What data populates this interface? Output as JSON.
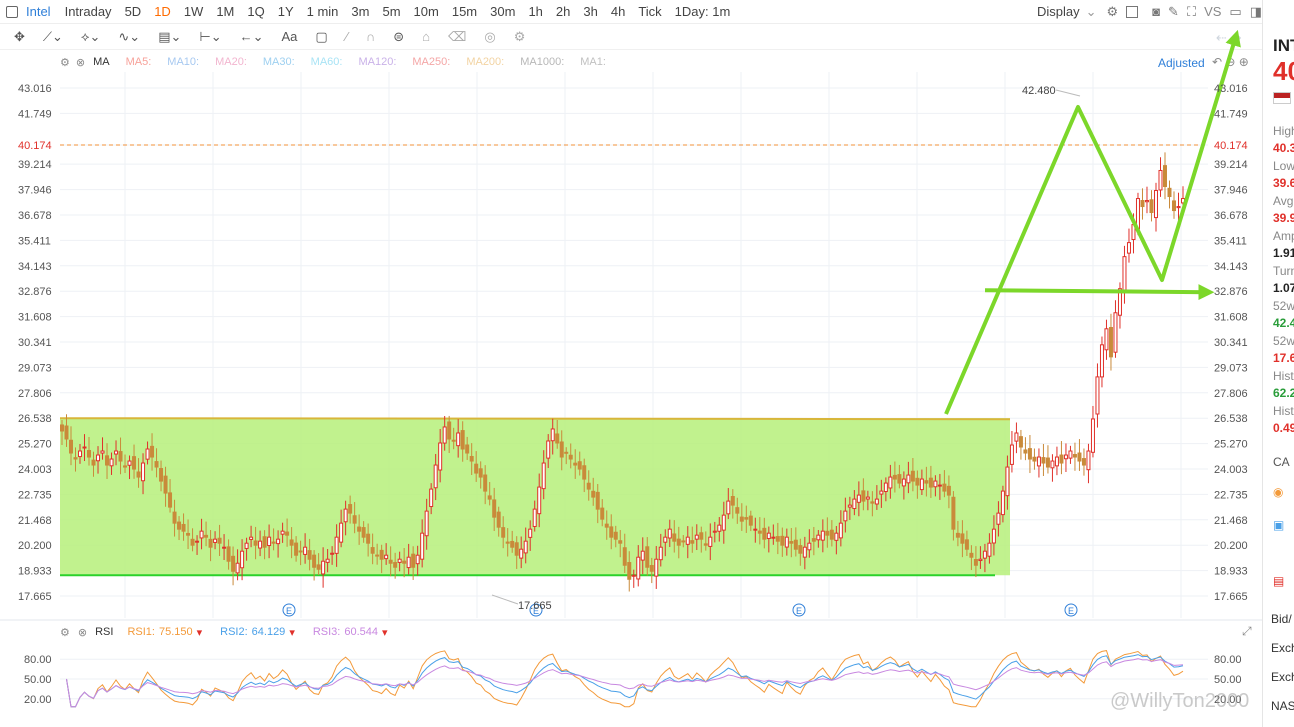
{
  "top_bar": {
    "brand": "Intel",
    "periods": [
      "Intraday",
      "5D",
      "1D",
      "1W",
      "1M",
      "1Q",
      "1Y",
      "1 min",
      "3m",
      "5m",
      "10m",
      "15m",
      "30m",
      "1h",
      "2h",
      "3h",
      "4h",
      "Tick",
      "1Day: 1m"
    ],
    "active_period": "1D",
    "display_label": "Display",
    "vs_label": "VS"
  },
  "ma_bar": {
    "indicator": "MA",
    "labels": [
      "MA5:",
      "MA10:",
      "MA20:",
      "MA30:",
      "MA60:",
      "MA120:",
      "MA250:",
      "MA200:",
      "MA1000:",
      "MA1:"
    ],
    "colors": [
      "#f7a29a",
      "#a6c8f0",
      "#f2b5cf",
      "#9ed0f0",
      "#a8e3f5",
      "#c9b1e8",
      "#f4a6a6",
      "#f2d3a2",
      "#b7b7b7",
      "#c0c0c0"
    ],
    "adjusted_label": "Adjusted"
  },
  "price_panel": {
    "last_price": "40.174",
    "high_marker": "42.480",
    "low_marker": "17.665",
    "earnings_marker": "E"
  },
  "rsi_bar": {
    "label": "RSI",
    "rsi1_label": "RSI1:",
    "rsi1": "75.150",
    "rsi2_label": "RSI2:",
    "rsi2": "64.129",
    "rsi3_label": "RSI3:",
    "rsi3": "60.544"
  },
  "right_panel": {
    "ticker": "INT",
    "price_partial": "40",
    "fields": [
      {
        "label": "High",
        "value": "40.3",
        "color": "#e0302a"
      },
      {
        "label": "Low",
        "value": "39.6",
        "color": "#e0302a"
      },
      {
        "label": "Avg",
        "value": "39.9",
        "color": "#e0302a"
      },
      {
        "label": "Amp",
        "value": "1.91",
        "color": "#222"
      },
      {
        "label": "Turn",
        "value": "1.07",
        "color": "#222"
      },
      {
        "label": "52w",
        "value": "42.4",
        "color": "#2a9d3a"
      },
      {
        "label": "52w",
        "value": "17.6",
        "color": "#e0302a"
      },
      {
        "label": "Hist",
        "value": "62.2",
        "color": "#2a9d3a"
      },
      {
        "label": "Hist",
        "value": "0.49",
        "color": "#e0302a"
      }
    ],
    "ca_label": "CA",
    "bottom_rows": [
      "Bid/",
      "Exch",
      "Exch",
      "NAS"
    ]
  },
  "watermark": "@WillyTon2000",
  "colors": {
    "up": "#e0302a",
    "down": "#c98a3a",
    "grid": "#eef1f5",
    "range_fill": "#b6f07a",
    "range_top": "#d8b63a",
    "range_bottom": "#2bd12b",
    "arrow": "#7cd72a",
    "last_price_line": "#f0903a",
    "rsi1": "#f39a3a",
    "rsi2": "#4aa0e8",
    "rsi3": "#c888e0"
  },
  "chart_data": {
    "type": "candlestick",
    "y_ticks": [
      "43.016",
      "41.749",
      "40.174",
      "39.214",
      "37.946",
      "36.678",
      "35.411",
      "34.143",
      "32.876",
      "31.608",
      "30.341",
      "29.073",
      "27.806",
      "26.538",
      "25.270",
      "24.003",
      "22.735",
      "21.468",
      "20.200",
      "18.933",
      "17.665"
    ],
    "ylim": [
      17.0,
      44.4
    ],
    "n_candles": 250,
    "close": [
      25.9,
      25.5,
      24.8,
      24.5,
      24.9,
      25.1,
      24.6,
      24.2,
      24.7,
      24.9,
      24.2,
      24.5,
      24.9,
      24.4,
      24.1,
      24.4,
      24.0,
      23.6,
      24.3,
      25.0,
      24.6,
      24.1,
      23.4,
      22.8,
      22.1,
      21.3,
      21.0,
      20.9,
      20.7,
      20.2,
      20.4,
      20.9,
      20.6,
      20.1,
      20.5,
      20.3,
      20.1,
      19.4,
      18.9,
      19.3,
      19.9,
      20.3,
      20.6,
      20.2,
      20.4,
      20.1,
      20.6,
      20.3,
      20.5,
      20.9,
      20.7,
      20.2,
      19.7,
      19.9,
      20.1,
      19.5,
      19.1,
      19.0,
      19.4,
      19.5,
      19.8,
      20.6,
      21.3,
      22.0,
      21.8,
      21.3,
      20.9,
      20.6,
      20.3,
      19.8,
      19.7,
      19.5,
      19.7,
      19.3,
      19.1,
      19.5,
      19.3,
      19.6,
      19.1,
      19.7,
      20.8,
      21.9,
      23.0,
      24.2,
      25.3,
      26.1,
      25.5,
      25.4,
      25.8,
      25.0,
      24.8,
      24.4,
      23.8,
      23.6,
      22.9,
      22.5,
      21.6,
      21.1,
      20.6,
      20.3,
      20.1,
      19.7,
      20.0,
      20.4,
      21.0,
      22.0,
      23.1,
      24.3,
      25.4,
      26.0,
      25.3,
      24.6,
      24.8,
      24.5,
      24.2,
      24.0,
      23.5,
      23.0,
      22.6,
      22.0,
      21.5,
      21.1,
      20.6,
      20.5,
      20.3,
      19.2,
      18.5,
      18.7,
      19.6,
      19.9,
      19.1,
      18.9,
      19.5,
      20.1,
      20.6,
      21.0,
      20.4,
      20.2,
      20.4,
      20.6,
      20.3,
      20.7,
      20.5,
      20.2,
      20.6,
      20.9,
      21.2,
      21.7,
      22.4,
      22.2,
      21.8,
      21.4,
      21.5,
      21.2,
      21.0,
      20.8,
      20.5,
      20.8,
      20.6,
      20.4,
      20.2,
      20.6,
      20.3,
      20.0,
      19.8,
      20.1,
      20.3,
      20.4,
      20.7,
      20.9,
      20.7,
      20.5,
      20.8,
      21.3,
      21.9,
      22.2,
      22.5,
      22.7,
      22.4,
      22.6,
      22.3,
      22.5,
      22.9,
      23.3,
      23.6,
      23.5,
      23.3,
      23.5,
      23.7,
      23.4,
      23.2,
      23.5,
      23.3,
      23.1,
      23.4,
      23.2,
      22.9,
      22.7,
      21.0,
      20.6,
      20.3,
      20.0,
      19.6,
      19.2,
      19.5,
      19.9,
      20.3,
      21.0,
      21.8,
      22.9,
      24.1,
      25.2,
      25.8,
      25.1,
      24.8,
      24.5,
      24.4,
      24.6,
      24.3,
      24.1,
      24.4,
      24.6,
      24.3,
      24.7,
      24.9,
      24.6,
      24.4,
      24.2,
      24.9,
      26.5,
      28.6,
      30.2,
      31.0,
      29.6,
      31.8,
      33.0,
      34.6,
      35.3,
      36.2,
      37.5,
      37.1,
      37.4,
      36.8,
      37.9,
      38.9,
      38.1,
      37.6,
      36.9,
      37.1,
      37.5,
      37.0,
      38.3,
      39.5,
      40.7,
      41.9,
      41.3,
      40.4,
      39.7,
      39.1,
      38.2,
      37.6,
      37.2,
      36.5,
      35.8,
      35.0,
      34.5,
      34.0,
      33.6,
      34.3,
      35.1,
      35.8,
      36.4,
      38.0,
      39.6,
      40.1
    ],
    "rsi_ticks": [
      "80.00",
      "50.00",
      "20.00"
    ],
    "rsi_range": [
      0,
      100
    ],
    "range_box": {
      "top": 26.538,
      "bottom": 18.7
    },
    "support_line": 32.876,
    "annotations": [
      "42.480",
      "17.665"
    ]
  }
}
